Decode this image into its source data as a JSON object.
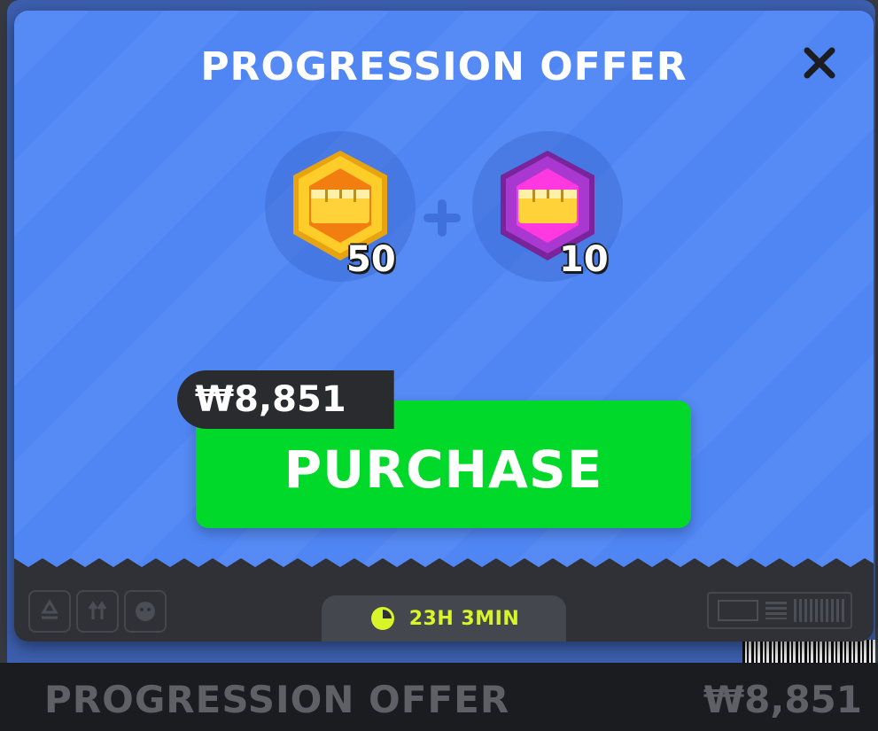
{
  "modal": {
    "title": "PROGRESSION OFFER",
    "close_icon": "close-icon"
  },
  "rewards": [
    {
      "name": "gold-token-icon",
      "quantity": "50",
      "color": "#f5b818"
    },
    {
      "name": "purple-token-icon",
      "quantity": "10",
      "color": "#a233c9"
    }
  ],
  "plus_icon": "plus-icon",
  "purchase": {
    "label": "PURCHASE",
    "price": "₩8,851",
    "color": "#00d92a"
  },
  "timer": {
    "icon": "clock-icon",
    "text": "23H 3MIN",
    "color": "#d8f52a"
  },
  "background_card": {
    "title": "PROGRESSION OFFER",
    "price": "₩8,851"
  },
  "colors": {
    "modal_bg": "#5086f4",
    "footer_bg": "#2f3136"
  }
}
